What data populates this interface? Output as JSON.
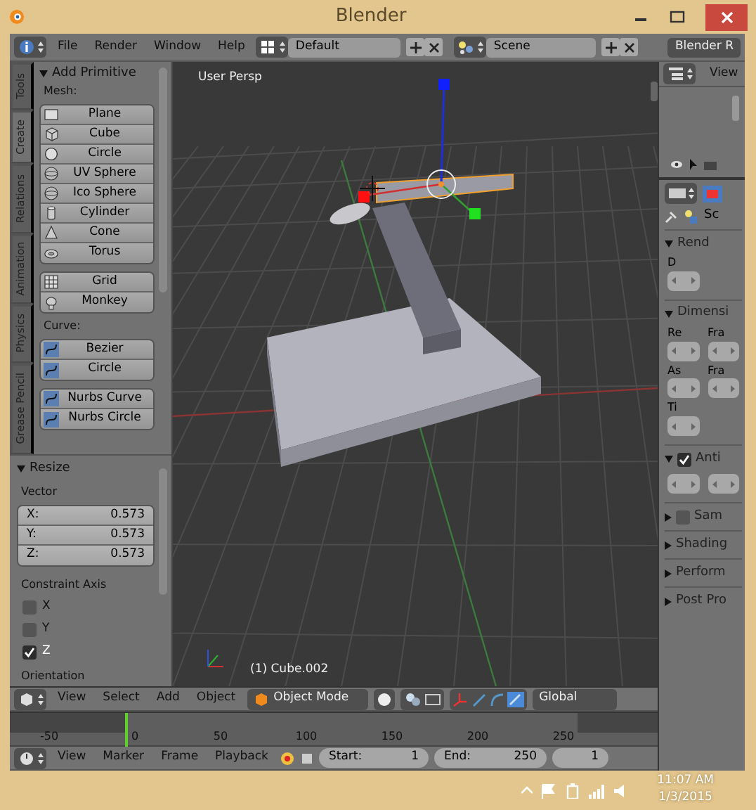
{
  "window": {
    "title": "Blender"
  },
  "info_header": {
    "menus": [
      "File",
      "Render",
      "Window",
      "Help"
    ],
    "layout": "Default",
    "scene": "Scene",
    "engine": "Blender R"
  },
  "toolshelf": {
    "tabs": [
      {
        "label": "Tools",
        "selected": false
      },
      {
        "label": "Create",
        "selected": true
      },
      {
        "label": "Relations",
        "selected": false
      },
      {
        "label": "Animation",
        "selected": false
      },
      {
        "label": "Physics",
        "selected": false
      },
      {
        "label": "Grease Pencil",
        "selected": false
      }
    ],
    "panel": {
      "title": "Add Primitive",
      "expanded": true
    },
    "groups": [
      {
        "label": "Mesh:",
        "blocks": [
          [
            {
              "label": "Plane",
              "kind": "plane"
            },
            {
              "label": "Cube",
              "kind": "cube"
            },
            {
              "label": "Circle",
              "kind": "circle"
            },
            {
              "label": "UV Sphere",
              "kind": "sphere"
            },
            {
              "label": "Ico Sphere",
              "kind": "sphere"
            },
            {
              "label": "Cylinder",
              "kind": "cylinder"
            },
            {
              "label": "Cone",
              "kind": "cone"
            },
            {
              "label": "Torus",
              "kind": "torus"
            }
          ],
          [
            {
              "label": "Grid",
              "kind": "grid"
            },
            {
              "label": "Monkey",
              "kind": "head"
            }
          ]
        ]
      },
      {
        "label": "Curve:",
        "blocks": [
          [
            {
              "label": "Bezier",
              "kind": "curve"
            },
            {
              "label": "Circle",
              "kind": "curve"
            }
          ],
          [
            {
              "label": "Nurbs Curve",
              "kind": "curve"
            },
            {
              "label": "Nurbs Circle",
              "kind": "curve"
            }
          ]
        ]
      }
    ]
  },
  "operator_panel": {
    "title": "Resize",
    "expanded": true,
    "vector_label": "Vector",
    "fields": [
      {
        "label": "X:",
        "value": "0.573"
      },
      {
        "label": "Y:",
        "value": "0.573"
      },
      {
        "label": "Z:",
        "value": "0.573"
      }
    ],
    "constraint_label": "Constraint Axis",
    "axes": [
      {
        "label": "X",
        "checked": false
      },
      {
        "label": "Y",
        "checked": false
      },
      {
        "label": "Z",
        "checked": true
      }
    ],
    "orientation_label": "Orientation"
  },
  "viewport": {
    "view_name": "User Persp",
    "object_name": "(1) Cube.002"
  },
  "view3d_header": {
    "menus": [
      "View",
      "Select",
      "Add",
      "Object"
    ],
    "mode": "Object Mode",
    "orientation": "Global"
  },
  "timeline": {
    "ticks": [
      "-50",
      "0",
      "50",
      "100",
      "150",
      "200",
      "250"
    ],
    "menus": [
      "View",
      "Marker",
      "Frame",
      "Playback"
    ],
    "start": {
      "label": "Start:",
      "value": "1"
    },
    "end": {
      "label": "End:",
      "value": "250"
    },
    "current": "1"
  },
  "outliner": {
    "menu": "View"
  },
  "properties": {
    "context": "Sc",
    "panels": [
      {
        "title": "Rend",
        "expanded": true,
        "kind": "plain",
        "labels": [
          "D"
        ]
      },
      {
        "title": "Dimensi",
        "expanded": true,
        "kind": "plain",
        "labels": [
          "Re",
          "Fra",
          "As",
          "Fra",
          "Ti"
        ]
      },
      {
        "title": "Anti",
        "expanded": true,
        "kind": "toggle",
        "checked": true
      },
      {
        "title": "Sam",
        "expanded": false,
        "kind": "toggle",
        "checked": false
      },
      {
        "title": "Shading",
        "expanded": false,
        "kind": "plain"
      },
      {
        "title": "Perform",
        "expanded": false,
        "kind": "plain"
      },
      {
        "title": "Post Pro",
        "expanded": false,
        "kind": "plain"
      }
    ]
  },
  "taskbar": {
    "time": "11:07 AM",
    "date": "1/3/2015"
  }
}
